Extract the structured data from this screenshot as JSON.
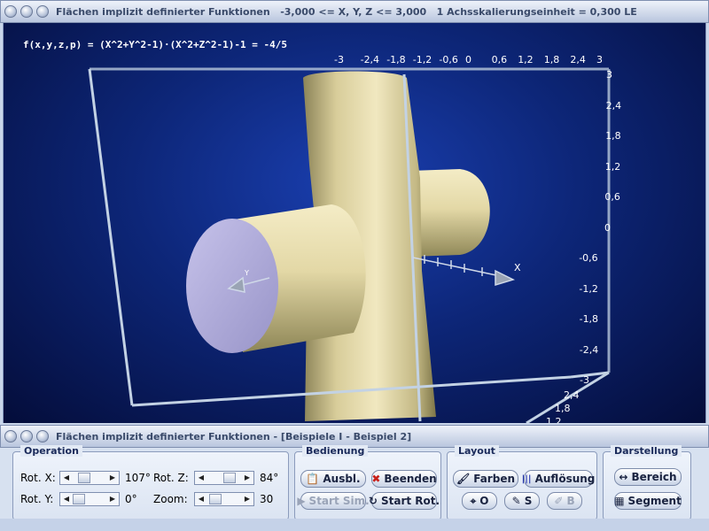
{
  "window": {
    "title": "Flächen implizit definierter Funktionen",
    "range": "-3,000 <= X, Y, Z <= 3,000",
    "scale": "1 Achsskalierungseinheit = 0,300 LE"
  },
  "subwindow": {
    "title": "Flächen implizit definierter Funktionen - [Beispiele I - Beispiel 2]"
  },
  "plot": {
    "formula": "f(x,y,z,p) = (X^2+Y^2-1)·(X^2+Z^2-1)-1 = -4/5",
    "top_ticks": [
      "-3",
      "-2,4",
      "-1,8",
      "-1,2",
      "-0,6",
      "0",
      "0,6",
      "1,2",
      "1,8",
      "2,4",
      "3"
    ],
    "right_ticks": [
      "3",
      "2,4",
      "1,8",
      "1,2",
      "0,6",
      "0",
      "-0,6",
      "-1,2",
      "-1,8",
      "-2,4",
      "-3"
    ],
    "bottom_ticks": [
      "2,4",
      "1,8",
      "1,2"
    ],
    "x_axis_label": "X",
    "y_axis_label": "Y",
    "colors": {
      "surface": "#e6dcae",
      "background": "#0d2678",
      "box": "#b8c8dc"
    }
  },
  "operation": {
    "label": "Operation",
    "rot_x_label": "Rot. X:",
    "rot_x_value": "107°",
    "rot_y_label": "Rot. Y:",
    "rot_y_value": "0°",
    "rot_z_label": "Rot. Z:",
    "rot_z_value": "84°",
    "zoom_label": "Zoom:",
    "zoom_value": "30"
  },
  "bedienung": {
    "label": "Bedienung",
    "ausbl": "Ausbl.",
    "beenden": "Beenden",
    "start_sim": "Start Sim.",
    "start_rot": "Start Rot."
  },
  "layout": {
    "label": "Layout",
    "farben": "Farben",
    "aufloesung": "Auflösung",
    "o": "O",
    "s": "S",
    "b": "B"
  },
  "darstellung": {
    "label": "Darstellung",
    "bereich": "Bereich",
    "segment": "Segment"
  }
}
